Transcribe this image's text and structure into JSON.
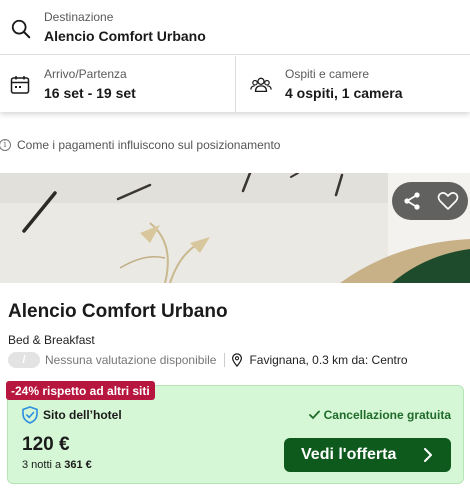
{
  "search": {
    "destination_label": "Destinazione",
    "destination_value": "Alencio Comfort Urbano",
    "dates_label": "Arrivo/Partenza",
    "dates_value": "16 set - 19 set",
    "guests_label": "Ospiti e camere",
    "guests_value": "4 ospiti, 1 camera"
  },
  "info_note": {
    "icon_glyph": "i",
    "text": "Come i pagamenti influiscono sul posizionamento"
  },
  "hotel": {
    "name": "Alencio Comfort Urbano",
    "type": "Bed & Breakfast",
    "rating_badge": "/",
    "rating_text": "Nessuna valutazione disponibile",
    "location": "Favignana, 0.3 km da: Centro"
  },
  "deal": {
    "discount_badge": "-24% rispetto ad altri siti",
    "site_label": "Sito dell’hotel",
    "cancellation": "Cancellazione gratuita",
    "price": "120 €",
    "nights_prefix": "3 notti a",
    "total_price": "361 €",
    "cta_label": "Vedi l'offerta"
  },
  "icons": {
    "search": "search-icon",
    "calendar": "calendar-icon",
    "guests": "guests-icon",
    "info": "info-icon",
    "share": "share-icon",
    "favorite": "heart-icon",
    "location": "location-pin-icon",
    "shield": "shield-check-icon",
    "check": "check-icon",
    "chevron": "chevron-right-icon"
  },
  "colors": {
    "discount_badge": "#b7163f",
    "deal_background": "#d6f7d6",
    "cta_button": "#0e5a1d",
    "cancellation_text": "#1f6b2a"
  }
}
